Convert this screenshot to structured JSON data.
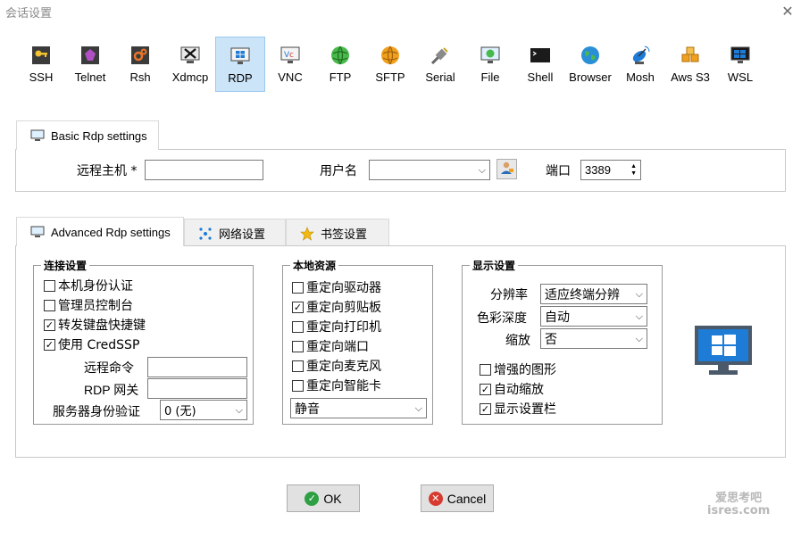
{
  "window": {
    "title": "会话设置",
    "close_glyph": "✕"
  },
  "toolbar": {
    "items": [
      {
        "label": "SSH",
        "icon": "key-icon"
      },
      {
        "label": "Telnet",
        "icon": "telnet-icon"
      },
      {
        "label": "Rsh",
        "icon": "gears-icon"
      },
      {
        "label": "Xdmcp",
        "icon": "xdmcp-icon"
      },
      {
        "label": "RDP",
        "icon": "windows-monitor-icon",
        "active": true
      },
      {
        "label": "VNC",
        "icon": "vnc-icon"
      },
      {
        "label": "FTP",
        "icon": "ftp-globe-icon"
      },
      {
        "label": "SFTP",
        "icon": "sftp-globe-icon"
      },
      {
        "label": "Serial",
        "icon": "serial-plug-icon"
      },
      {
        "label": "File",
        "icon": "file-monitor-icon"
      },
      {
        "label": "Shell",
        "icon": "terminal-icon"
      },
      {
        "label": "Browser",
        "icon": "browser-globe-icon"
      },
      {
        "label": "Mosh",
        "icon": "satellite-icon"
      },
      {
        "label": "Aws S3",
        "icon": "cubes-icon"
      },
      {
        "label": "WSL",
        "icon": "wsl-icon"
      }
    ]
  },
  "basic": {
    "tab_label": "Basic Rdp settings",
    "remote_host_label": "远程主机 *",
    "remote_host_value": "",
    "username_label": "用户名",
    "username_value": "",
    "port_label": "端口",
    "port_value": "3389"
  },
  "advanced": {
    "tabs": [
      {
        "label": "Advanced Rdp settings",
        "active": true
      },
      {
        "label": "网络设置"
      },
      {
        "label": "书签设置"
      }
    ],
    "connection": {
      "title": "连接设置",
      "checks": [
        {
          "label": "本机身份认证",
          "checked": false
        },
        {
          "label": "管理员控制台",
          "checked": false
        },
        {
          "label": "转发键盘快捷键",
          "checked": true
        },
        {
          "label": "使用 CredSSP",
          "checked": true
        }
      ],
      "remote_cmd_label": "远程命令",
      "remote_cmd_value": "",
      "rdp_gateway_label": "RDP 网关",
      "rdp_gateway_value": "",
      "server_auth_label": "服务器身份验证",
      "server_auth_value": "0 (无)"
    },
    "local": {
      "title": "本地资源",
      "checks": [
        {
          "label": "重定向驱动器",
          "checked": false
        },
        {
          "label": "重定向剪贴板",
          "checked": true
        },
        {
          "label": "重定向打印机",
          "checked": false
        },
        {
          "label": "重定向端口",
          "checked": false
        },
        {
          "label": "重定向麦克风",
          "checked": false
        },
        {
          "label": "重定向智能卡",
          "checked": false
        }
      ],
      "audio_value": "静音"
    },
    "display": {
      "title": "显示设置",
      "resolution_label": "分辨率",
      "resolution_value": "适应终端分辨",
      "color_depth_label": "色彩深度",
      "color_depth_value": "自动",
      "scale_label": "缩放",
      "scale_value": "否",
      "checks": [
        {
          "label": "增强的图形",
          "checked": false
        },
        {
          "label": "自动缩放",
          "checked": true
        },
        {
          "label": "显示设置栏",
          "checked": true
        }
      ]
    }
  },
  "buttons": {
    "ok": "OK",
    "cancel": "Cancel"
  },
  "watermark": {
    "line1": "爱思考吧",
    "line2": "isres.com"
  },
  "colors": {
    "active_tool_bg": "#cce4f7",
    "ok_green": "#2ea043",
    "cancel_red": "#d73a2f",
    "windows_blue": "#1e7bd6"
  }
}
